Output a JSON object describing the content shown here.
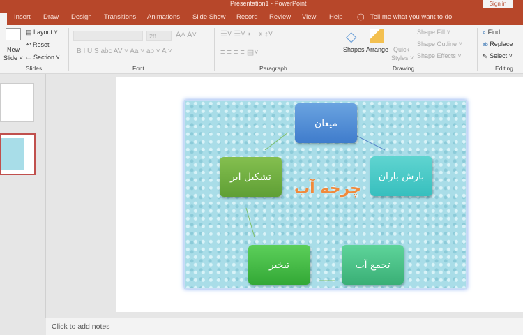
{
  "window": {
    "title": "Presentation1 - PowerPoint",
    "sign_in": "Sign in"
  },
  "tabs": [
    "Insert",
    "Draw",
    "Design",
    "Transitions",
    "Animations",
    "Slide Show",
    "Record",
    "Review",
    "View",
    "Help"
  ],
  "tell_me": "Tell me what you want to do",
  "ribbon": {
    "slides": {
      "label": "Slides",
      "new_slide": "New",
      "new_slide2": "Slide ˅",
      "layout": "Layout ˅",
      "reset": "Reset",
      "section": "Section ˅"
    },
    "font": {
      "label": "Font",
      "size": "28",
      "row2": "B  I  U  S  abc  AV ˅  Aa ˅  ab ˅  A ˅",
      "grow": "A˄ A˅"
    },
    "paragraph": {
      "label": "Paragraph"
    },
    "drawing": {
      "label": "Drawing",
      "shapes": "Shapes",
      "arrange": "Arrange",
      "quick_styles": "Quick",
      "quick_styles2": "Styles ˅",
      "shape_fill": "Shape Fill ˅",
      "shape_outline": "Shape Outline ˅",
      "shape_effects": "Shape Effects ˅"
    },
    "editing": {
      "label": "Editing",
      "find": "Find",
      "replace": "Replace",
      "select": "Select ˅"
    }
  },
  "slide": {
    "title": "چرخه آب",
    "boxes": [
      "میعان",
      "بارش باران",
      "تشکیل ابر",
      "تبخیر",
      "تجمع آب"
    ]
  },
  "notes": "Click to add notes",
  "colors": {
    "accent": "#b7472a"
  }
}
